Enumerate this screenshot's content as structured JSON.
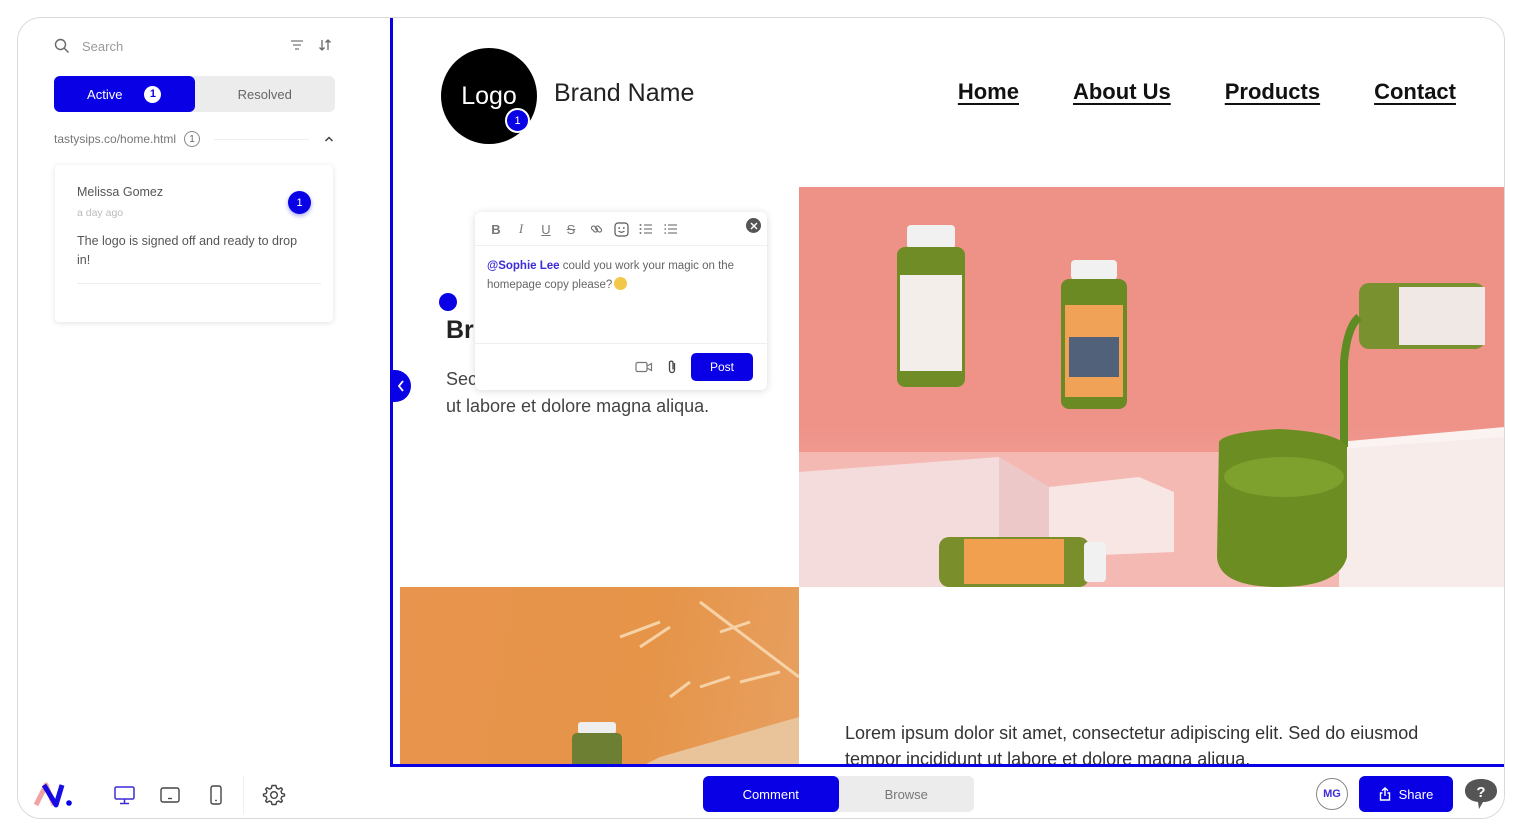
{
  "sidebar": {
    "search_placeholder": "Search",
    "tabs": [
      {
        "label": "Active",
        "count": "1",
        "active": true
      },
      {
        "label": "Resolved",
        "active": false
      }
    ],
    "page_group": {
      "url": "tastysips.co/home.html",
      "count": "1"
    },
    "comments": [
      {
        "author": "Melissa Gomez",
        "time": "a day ago",
        "body": "The logo is signed off and ready to drop in!",
        "pin": "1"
      }
    ]
  },
  "preview": {
    "logo_text": "Logo",
    "logo_pin": "1",
    "brand_name": "Brand Name",
    "nav": [
      "Home",
      "About Us",
      "Products",
      "Contact"
    ],
    "hero_heading": "Br",
    "hero_text": "Sec ut labore et dolore magna aliqua.",
    "hero_text_line1": "Sec",
    "hero_text_line2": "ut labore et dolore magna aliqua.",
    "lorem": "Lorem ipsum dolor sit amet, consectetur adipiscing elit. Sed do eiusmod tempor incididunt ut labore et dolore magna aliqua."
  },
  "composer": {
    "toolbar": [
      "bold",
      "italic",
      "underline",
      "strikethrough",
      "link",
      "emoji",
      "ordered-list",
      "bullet-list"
    ],
    "mention": "@Sophie Lee",
    "message": " could you work your magic on the homepage copy please?",
    "post_label": "Post"
  },
  "bottom_bar": {
    "devices": [
      "desktop",
      "tablet",
      "mobile"
    ],
    "active_device": "desktop",
    "modes": [
      {
        "label": "Comment",
        "active": true
      },
      {
        "label": "Browse",
        "active": false
      }
    ],
    "avatar_initials": "MG",
    "share_label": "Share",
    "help_label": "?"
  },
  "colors": {
    "accent": "#0a00e6",
    "hero_bg": "#ef9389",
    "secondary_bg": "#e8944e"
  }
}
